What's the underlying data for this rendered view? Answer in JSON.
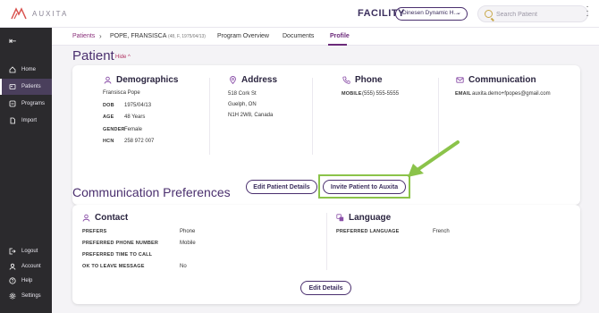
{
  "header": {
    "logo_text": "AUXITA",
    "facility_label": "FACILITY",
    "facility_value": "Dinesen Dynamic H...",
    "search_placeholder": "Search Patient"
  },
  "sidebar": {
    "items": [
      {
        "label": "Home",
        "icon": "home-icon"
      },
      {
        "label": "Patients",
        "icon": "patients-icon",
        "active": true
      },
      {
        "label": "Programs",
        "icon": "programs-icon"
      },
      {
        "label": "Import",
        "icon": "import-icon"
      }
    ],
    "bottom_items": [
      {
        "label": "Logout",
        "icon": "logout-icon"
      },
      {
        "label": "Account",
        "icon": "account-icon"
      },
      {
        "label": "Help",
        "icon": "help-icon"
      },
      {
        "label": "Settings",
        "icon": "settings-icon"
      }
    ]
  },
  "breadcrumb": {
    "patients": "Patients",
    "name": "POPE, FRANSISCA",
    "meta": "(48, F, 1975/04/13)"
  },
  "tabs": [
    "Program Overview",
    "Documents",
    "Profile"
  ],
  "patient": {
    "title": "Patient",
    "hide_label": "Hide ^",
    "demographics": {
      "title": "Demographics",
      "name": "Fransisca Pope",
      "dob_label": "DOB",
      "dob": "1975/04/13",
      "age_label": "AGE",
      "age": "48 Years",
      "gender_label": "GENDER",
      "gender": "Female",
      "hcn_label": "HCN",
      "hcn": "258 972 007"
    },
    "address": {
      "title": "Address",
      "line1": "518 Cork St",
      "line2": "Guelph, ON",
      "line3": "N1H 2W8, Canada"
    },
    "phone": {
      "title": "Phone",
      "mobile_label": "MOBILE",
      "mobile": "(555) 555-5555"
    },
    "communication": {
      "title": "Communication",
      "email_label": "EMAIL",
      "email": "auxita.demo+fpopes@gmail.com"
    },
    "edit_button": "Edit Patient Details",
    "invite_button": "Invite Patient to Auxita"
  },
  "comm_prefs": {
    "title": "Communication Preferences",
    "contact": {
      "title": "Contact",
      "rows": [
        {
          "label": "PREFERS",
          "value": "Phone"
        },
        {
          "label": "PREFERRED PHONE NUMBER",
          "value": "Mobile"
        },
        {
          "label": "PREFERRED TIME TO CALL",
          "value": ""
        },
        {
          "label": "OK TO LEAVE MESSAGE",
          "value": "No"
        }
      ]
    },
    "language": {
      "title": "Language",
      "label": "PREFERRED LANGUAGE",
      "value": "French"
    },
    "edit_button": "Edit Details"
  },
  "colors": {
    "sidebar": "#2b2a2d",
    "accent": "#4a2f6e",
    "highlight": "#8bc34a",
    "hide_link": "#b03060"
  }
}
